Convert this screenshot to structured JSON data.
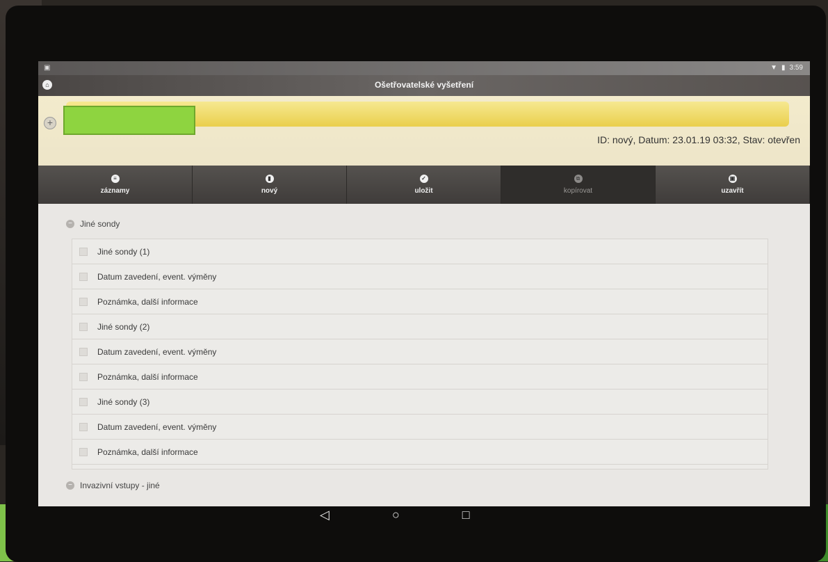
{
  "status_bar": {
    "time": "3:59"
  },
  "app_bar": {
    "title": "Ošetřovatelské vyšetření"
  },
  "patient_header": {
    "meta": "ID: nový, Datum: 23.01.19 03:32, Stav: otevřen",
    "name_redacted_color": "#8ed440"
  },
  "toolbar": {
    "items": [
      {
        "label": "záznamy",
        "icon": "list-icon"
      },
      {
        "label": "nový",
        "icon": "new-document-icon"
      },
      {
        "label": "uložit",
        "icon": "check-icon"
      },
      {
        "label": "kopírovat",
        "icon": "copy-icon",
        "disabled": true
      },
      {
        "label": "uzavřít",
        "icon": "lock-icon"
      }
    ]
  },
  "sections": {
    "first": {
      "title": "Jiné sondy",
      "rows": [
        "Jiné sondy (1)",
        "Datum zavedení, event. výměny",
        "Poznámka, další informace",
        "Jiné sondy (2)",
        "Datum zavedení, event. výměny",
        "Poznámka, další informace",
        "Jiné sondy (3)",
        "Datum zavedení, event. výměny",
        "Poznámka, další informace"
      ]
    },
    "second": {
      "title": "Invazivní vstupy - jiné"
    }
  },
  "nav_bar": {
    "back": "◁",
    "home": "○",
    "recents": "□"
  }
}
